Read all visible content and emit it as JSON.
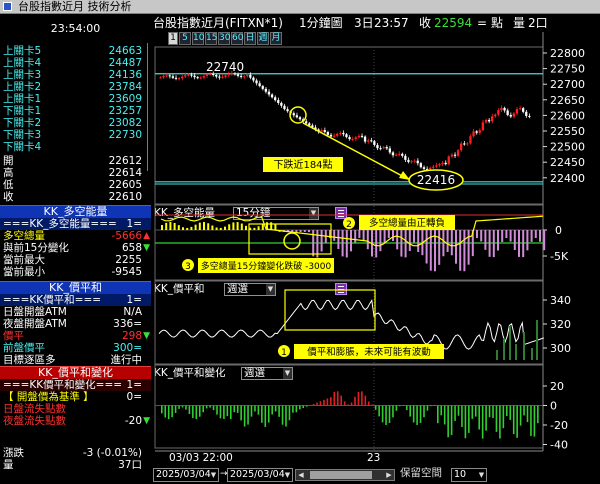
{
  "window": {
    "title": "台股指數近月 技術分析"
  },
  "left_panel": {
    "clock": "23:54:00",
    "gates": [
      {
        "label": "上關卡5",
        "value": "24663",
        "color": "cyan"
      },
      {
        "label": "上關卡4",
        "value": "24487",
        "color": "cyan"
      },
      {
        "label": "上關卡3",
        "value": "24136",
        "color": "cyan"
      },
      {
        "label": "上關卡2",
        "value": "23784",
        "color": "cyan"
      },
      {
        "label": "上關卡1",
        "value": "23609",
        "color": "cyan"
      },
      {
        "label": "下關卡1",
        "value": "23257",
        "color": "cyan"
      },
      {
        "label": "下關卡2",
        "value": "23082",
        "color": "cyan"
      },
      {
        "label": "下關卡3",
        "value": "22730",
        "color": "cyan"
      },
      {
        "label": "下關卡4",
        "value": "",
        "color": "cyan"
      }
    ],
    "ohlc": [
      {
        "label": "開",
        "value": "22612"
      },
      {
        "label": "高",
        "value": "22614"
      },
      {
        "label": "低",
        "value": "22605"
      },
      {
        "label": "收",
        "value": "22610"
      }
    ],
    "kk_power": {
      "header": "KK_多空能量",
      "sub_label": "===KK_多空能量===",
      "sub_value": "1=",
      "rows": [
        {
          "label": "多空總量",
          "value": "-5666",
          "arrow": "up",
          "label_color": "yellow",
          "value_color": "red"
        },
        {
          "label": "與前15分變化",
          "value": "658",
          "arrow": "down",
          "label_color": "white",
          "value_color": "white"
        },
        {
          "label": "當前最大",
          "value": "2255",
          "arrow": "",
          "label_color": "white",
          "value_color": "white"
        },
        {
          "label": "當前最小",
          "value": "-9545",
          "arrow": "",
          "label_color": "white",
          "value_color": "white"
        }
      ]
    },
    "kk_balance": {
      "header": "KK_價平和",
      "sub_label": "===KK價平和===",
      "sub_value": "1=",
      "rows": [
        {
          "label": "日盤開盤ATM",
          "value": "N/A",
          "arrow": "",
          "label_color": "white",
          "value_color": "white"
        },
        {
          "label": "夜盤開盤ATM",
          "value": "336=",
          "arrow": "",
          "label_color": "white",
          "value_color": "white"
        },
        {
          "label": "價平",
          "value": "298",
          "arrow": "down",
          "label_color": "red",
          "value_color": "red"
        },
        {
          "label": "前盤價平",
          "value": "300=",
          "arrow": "",
          "label_color": "cyan",
          "value_color": "cyan"
        },
        {
          "label": "目標逐區多",
          "value": "進行中",
          "arrow": "",
          "label_color": "white",
          "value_color": "white"
        }
      ]
    },
    "kk_balance_change": {
      "header": "KK_價平和變化",
      "sub_label": "===KK價平和變化===",
      "sub_value": "1=",
      "rows": [
        {
          "label": "【 開盤價為基準 】",
          "value": "0=",
          "arrow": "",
          "label_color": "yellow",
          "value_color": "white"
        },
        {
          "label": "日盤流失點數",
          "value": "",
          "arrow": "",
          "label_color": "red",
          "value_color": "white"
        },
        {
          "label": "夜盤流失點數",
          "value": "-20",
          "arrow": "down",
          "label_color": "red",
          "value_color": "white"
        }
      ]
    },
    "footer": [
      {
        "label": "漲跌",
        "value": "-3 (-0.01%)"
      },
      {
        "label": "量",
        "value": "37口"
      }
    ]
  },
  "header": {
    "symbol": "台股指數近月(FITXN*1)",
    "interval": "1分鐘圖",
    "date": "3日",
    "time": "23:57",
    "close_label": "收",
    "close_value": "22594",
    "equal": "=",
    "unit": "點",
    "volume_label": "量",
    "volume_value": "2口"
  },
  "toolbar": {
    "buttons": [
      "1",
      "5",
      "10",
      "15",
      "30",
      "60",
      "日",
      "週",
      "月"
    ],
    "active_index": 0
  },
  "price_pane": {
    "high_label": "22740",
    "low_label": "22416",
    "annotation": "下跌近184點",
    "y_ticks": [
      "22800",
      "22750",
      "22700",
      "22650",
      "22600",
      "22550",
      "22500",
      "22450",
      "22400"
    ]
  },
  "power_pane": {
    "title": "KK_多空能量",
    "period": "15分鐘",
    "note2_num": "2",
    "note2_text": "多空總量由正轉負",
    "note3_num": "3",
    "note3_text": "多空總量15分鐘變化跌破 -3000",
    "y_ticks": [
      "0",
      "-5K"
    ]
  },
  "balance_pane": {
    "title": "KK_價平和",
    "period": "週選",
    "note1_num": "1",
    "note1_text": "價平和膨脹，未來可能有波動",
    "y_ticks": [
      "340",
      "320",
      "300"
    ]
  },
  "change_pane": {
    "title": "KK_價平和變化",
    "period": "週選",
    "y_ticks": [
      "20",
      "0",
      "-20",
      "-40"
    ]
  },
  "xaxis": {
    "labels": [
      "03/03 22:00",
      "23"
    ]
  },
  "bottom_bar": {
    "from_date": "2025/03/04",
    "to_date": "2025/03/04",
    "reserve_label": "保留空間",
    "reserve_value": "10"
  },
  "colors": {
    "up_candle": "#ff2020",
    "down_candle": "#ffffff",
    "cyan_line": "#40e0e0",
    "yellow": "#ffff00",
    "pink_bar": "#d08cd8",
    "green_bar": "#30d030",
    "red_bar": "#e02020",
    "panel_blue": "#0f34b5",
    "panel_red": "#b70000"
  }
}
